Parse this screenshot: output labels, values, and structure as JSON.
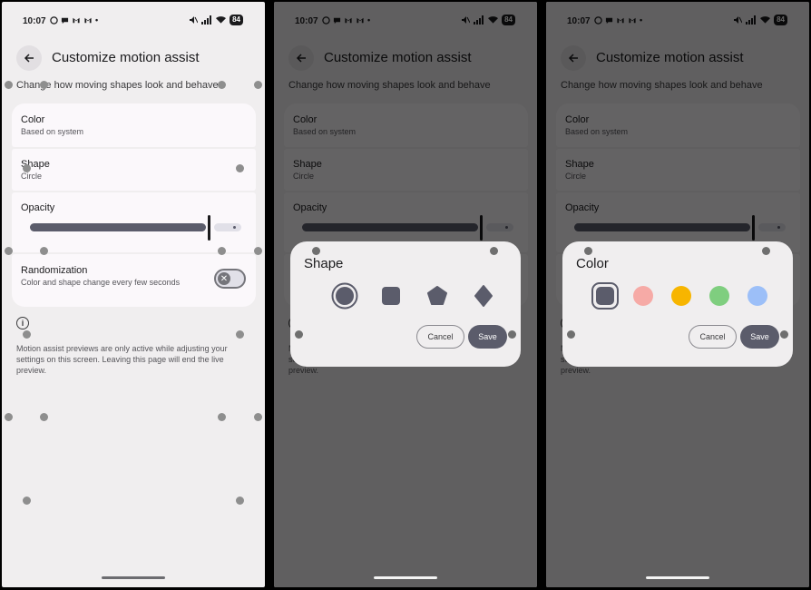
{
  "status": {
    "time": "10:07",
    "battery": "84"
  },
  "screen": {
    "title": "Customize motion assist",
    "subtitle": "Change how moving shapes look and behave",
    "settings": {
      "color": {
        "title": "Color",
        "value": "Based on system"
      },
      "shape": {
        "title": "Shape",
        "value": "Circle"
      },
      "opacity": {
        "title": "Opacity",
        "level_fraction": 0.86
      },
      "randomization": {
        "title": "Randomization",
        "description": "Color and shape change every few seconds",
        "enabled": false
      }
    },
    "info": "Motion assist previews are only active while adjusting your settings on this screen. Leaving this page will end the live preview."
  },
  "dialogs": {
    "shape": {
      "title": "Shape",
      "options": [
        "circle",
        "square",
        "pentagon",
        "diamond"
      ],
      "selected": "circle",
      "cancel": "Cancel",
      "save": "Save"
    },
    "color": {
      "title": "Color",
      "options": [
        "#5b5c6b",
        "#f6aaa6",
        "#f7b500",
        "#7fce7f",
        "#9cbff8"
      ],
      "selected_index": 0,
      "cancel": "Cancel",
      "save": "Save"
    }
  },
  "icons": {
    "back": "arrow-left-icon",
    "info": "info-icon",
    "toggle_off": "close-icon"
  }
}
